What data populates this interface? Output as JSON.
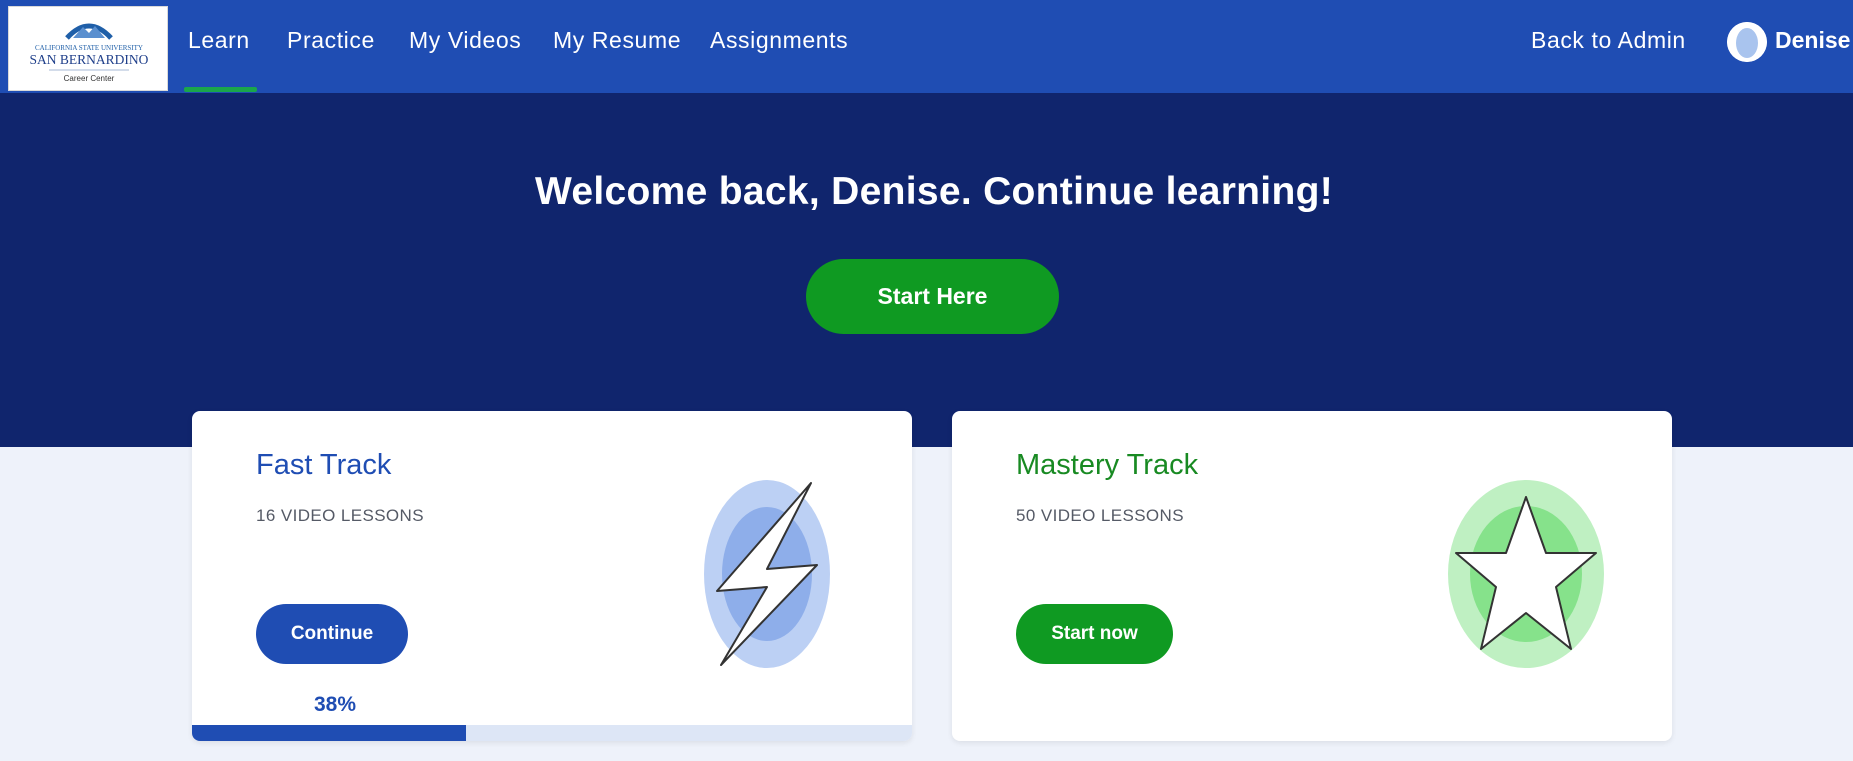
{
  "logo": {
    "line1": "CALIFORNIA STATE UNIVERSITY",
    "line2": "SAN BERNARDINO",
    "line3": "Career Center"
  },
  "nav": {
    "items": [
      {
        "label": "Learn",
        "active": true
      },
      {
        "label": "Practice",
        "active": false
      },
      {
        "label": "My Videos",
        "active": false
      },
      {
        "label": "My Resume",
        "active": false
      },
      {
        "label": "Assignments",
        "active": false
      }
    ],
    "back_to_admin": "Back to Admin",
    "user_name": "Denise"
  },
  "hero": {
    "title": "Welcome back, Denise. Continue learning!",
    "start_button": "Start Here"
  },
  "cards": {
    "fast": {
      "title": "Fast Track",
      "subtitle": "16 VIDEO LESSONS",
      "button": "Continue",
      "progress_label": "38%",
      "progress": 0.38,
      "icon": "lightning-bolt-icon"
    },
    "mastery": {
      "title": "Mastery Track",
      "subtitle": "50 VIDEO LESSONS",
      "button": "Start now",
      "icon": "star-icon"
    }
  },
  "colors": {
    "nav_blue": "#1f4db3",
    "hero_navy": "#10256d",
    "green": "#0f9a22",
    "title_blue": "#1f4db3",
    "title_green": "#188a22"
  }
}
